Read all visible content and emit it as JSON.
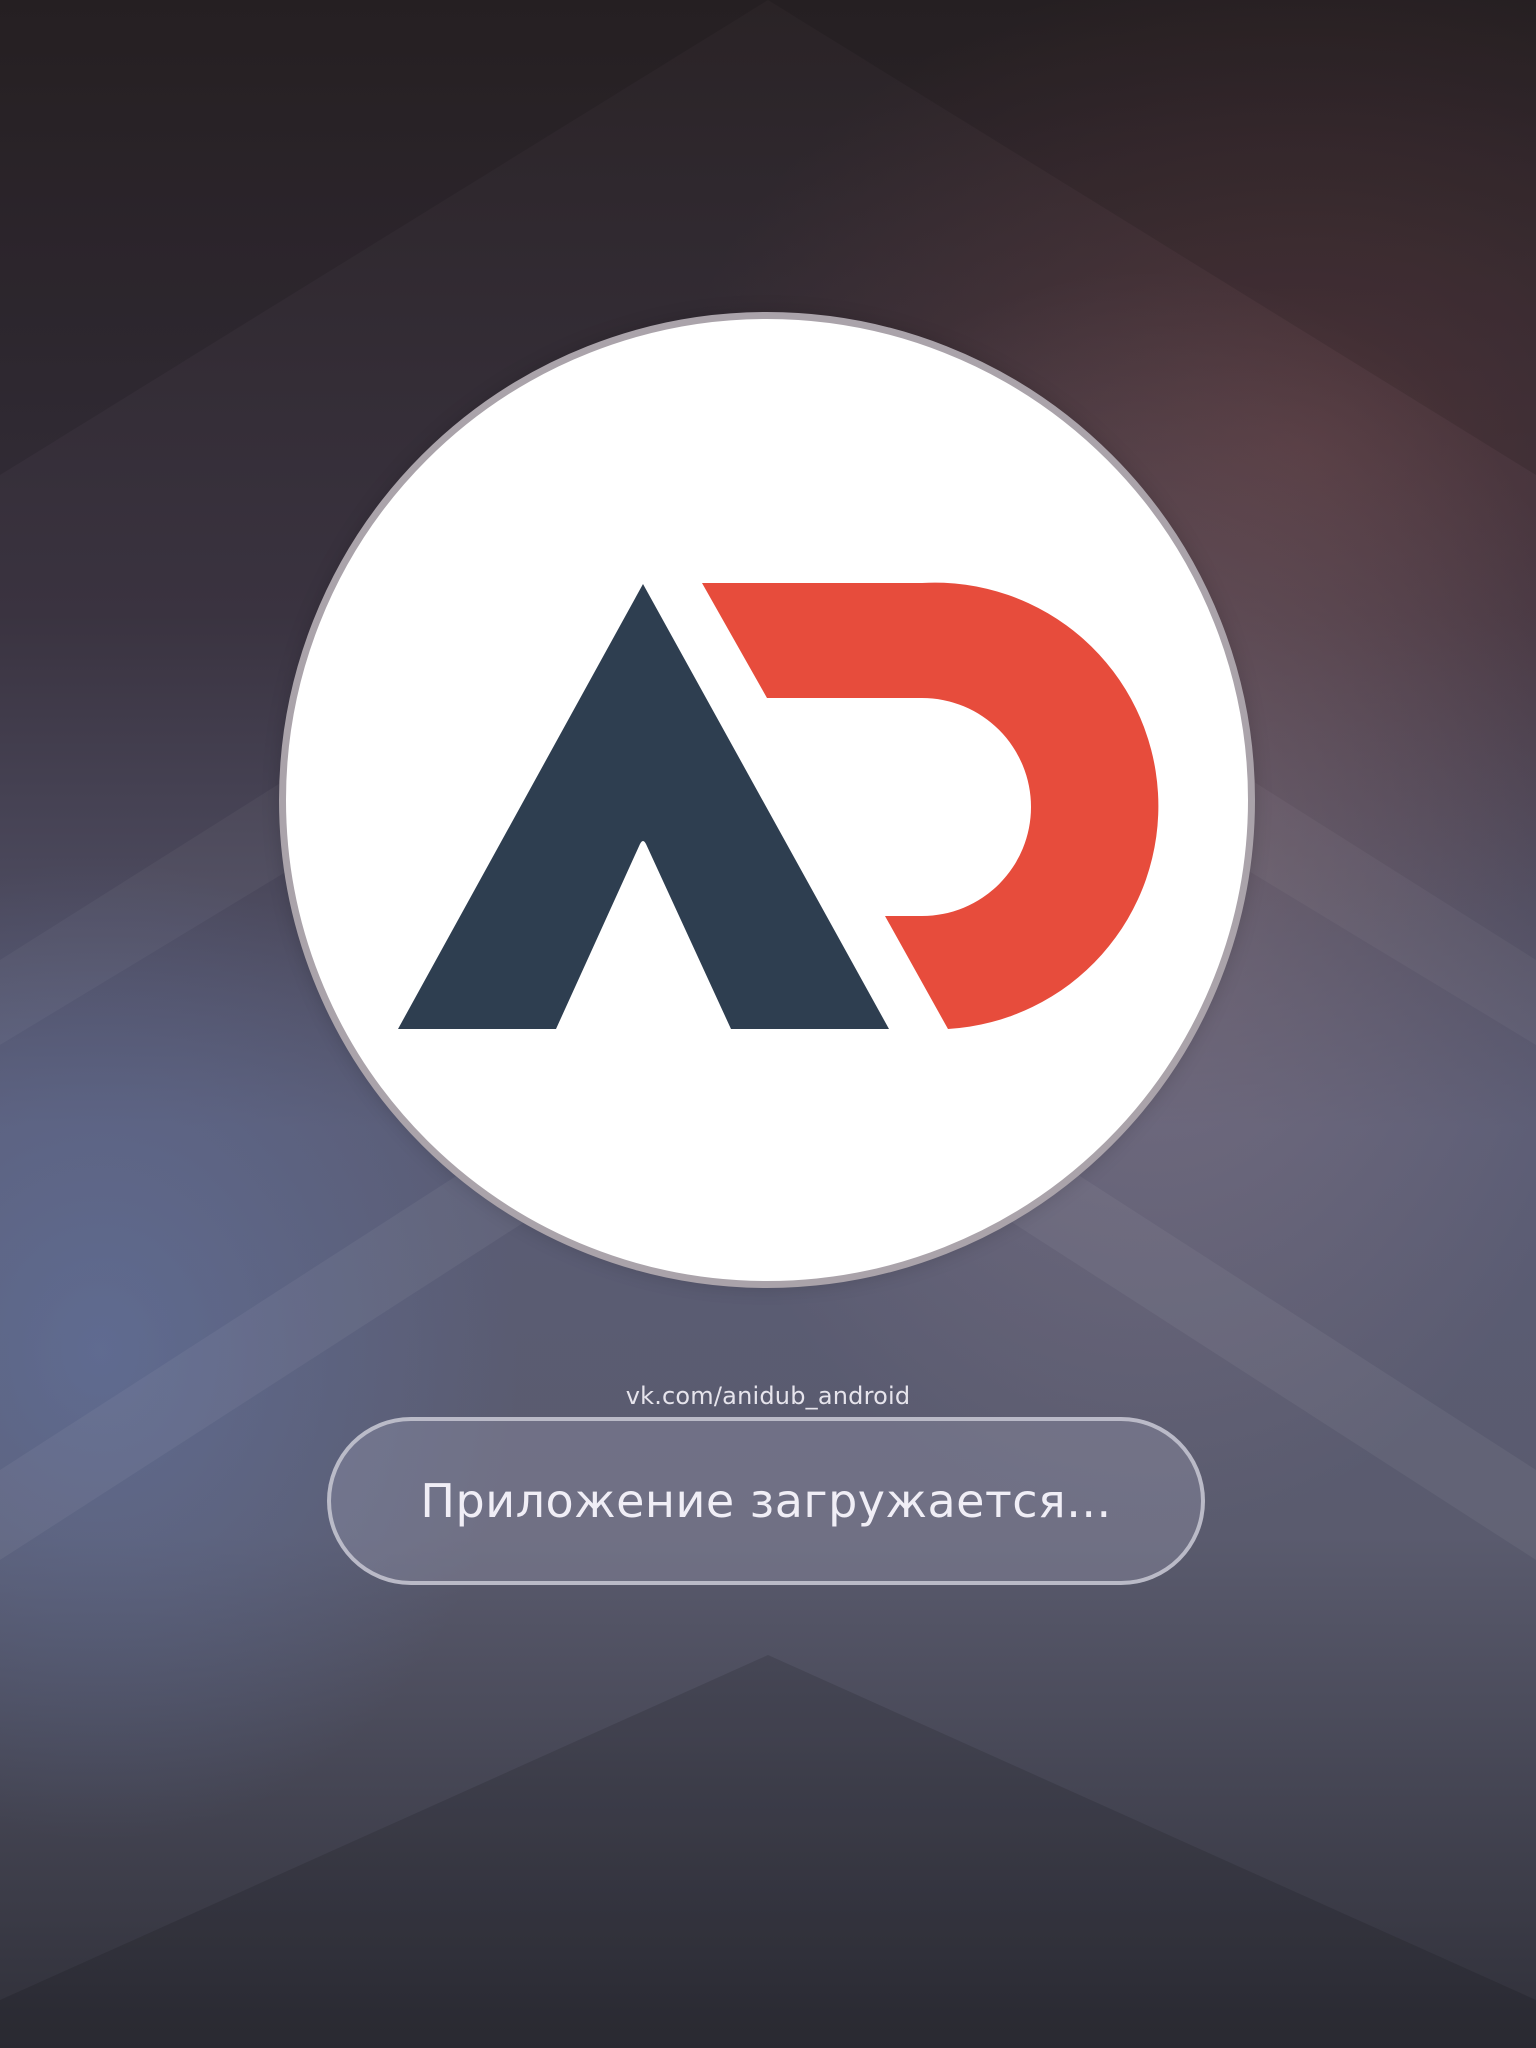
{
  "splash": {
    "url": "vk.com/anidub_android",
    "loading_text": "Приложение загружается..."
  },
  "logo": {
    "letters": "AD",
    "colors": {
      "a_color": "#2e3e50",
      "d_color": "#e74c3c",
      "circle_fill": "#ffffff",
      "circle_border": "#aaa3aa"
    }
  },
  "colors": {
    "background_top": "#2a2326",
    "background_mid": "#5a5c75",
    "text": "#f0eef6"
  }
}
